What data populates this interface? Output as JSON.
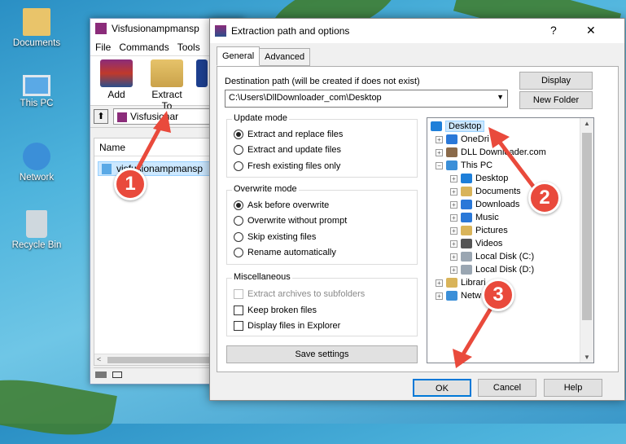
{
  "desktop": {
    "icons": [
      {
        "label": "Documents"
      },
      {
        "label": "This PC"
      },
      {
        "label": "Network"
      },
      {
        "label": "Recycle Bin"
      }
    ]
  },
  "rar_window": {
    "title": "Visfusionampmansp",
    "menu": [
      "File",
      "Commands",
      "Tools"
    ],
    "tools": [
      {
        "label": "Add"
      },
      {
        "label": "Extract To"
      }
    ],
    "path": "Visfusionar",
    "column_name": "Name",
    "file": "visfusionampmansp"
  },
  "dialog": {
    "title": "Extraction path and options",
    "help_glyph": "?",
    "close_glyph": "✕",
    "tabs": [
      "General",
      "Advanced"
    ],
    "dest_label": "Destination path (will be created if does not exist)",
    "dest_value": "C:\\Users\\DllDownloader_com\\Desktop",
    "display_button": "Display",
    "new_folder_button": "New Folder",
    "update_mode": {
      "title": "Update mode",
      "options": [
        "Extract and replace files",
        "Extract and update files",
        "Fresh existing files only"
      ],
      "selected": 0
    },
    "overwrite_mode": {
      "title": "Overwrite mode",
      "options": [
        "Ask before overwrite",
        "Overwrite without prompt",
        "Skip existing files",
        "Rename automatically"
      ],
      "selected": 0
    },
    "misc": {
      "title": "Miscellaneous",
      "options": [
        {
          "label": "Extract archives to subfolders",
          "checked": false,
          "disabled": true
        },
        {
          "label": "Keep broken files",
          "checked": false,
          "disabled": false
        },
        {
          "label": "Display files in Explorer",
          "checked": false,
          "disabled": false
        }
      ]
    },
    "save_settings": "Save settings",
    "tree": [
      {
        "label": "Desktop",
        "icon_color": "#1e7fd9"
      },
      {
        "label": "OneDri",
        "icon_color": "#2a78d8"
      },
      {
        "label": "DLL Downloader.com",
        "icon_color": "#8a6a4a"
      },
      {
        "label": "This PC",
        "icon_color": "#3b8fd8"
      },
      {
        "label": "Desktop",
        "icon_color": "#1e7fd9"
      },
      {
        "label": "Documents",
        "icon_color": "#d9b45a"
      },
      {
        "label": "Downloads",
        "icon_color": "#2a78d8"
      },
      {
        "label": "Music",
        "icon_color": "#2a78d8"
      },
      {
        "label": "Pictures",
        "icon_color": "#d9b45a"
      },
      {
        "label": "Videos",
        "icon_color": "#555555"
      },
      {
        "label": "Local Disk (C:)",
        "icon_color": "#9aa6b2"
      },
      {
        "label": "Local Disk (D:)",
        "icon_color": "#9aa6b2"
      },
      {
        "label": "Librari",
        "icon_color": "#d9b45a"
      },
      {
        "label": "Netw",
        "icon_color": "#3b8fd8"
      }
    ],
    "ok": "OK",
    "cancel": "Cancel",
    "help": "Help"
  },
  "annotations": [
    "1",
    "2",
    "3"
  ],
  "colors": {
    "badge": "#e94a3c",
    "selection": "#cce8ff"
  }
}
